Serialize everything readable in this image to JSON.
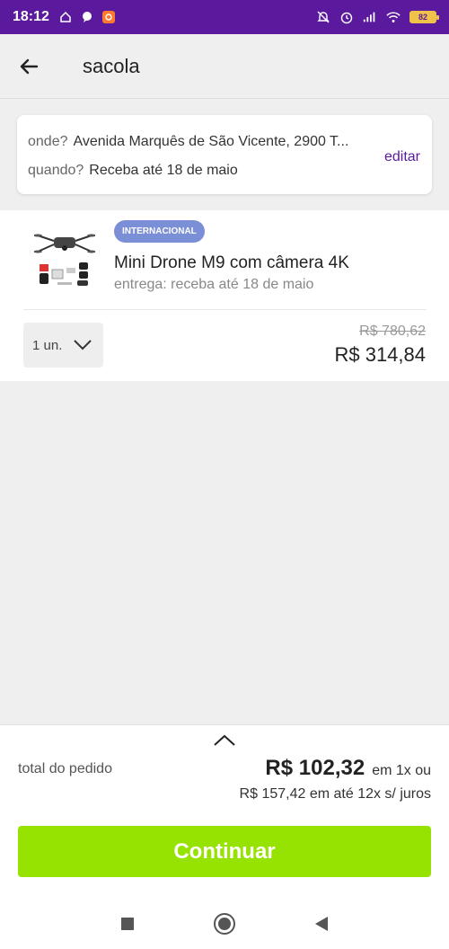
{
  "status_bar": {
    "time": "18:12",
    "battery": "82",
    "left_icons": [
      "home-icon",
      "chat-icon",
      "app-badge-icon"
    ],
    "right_icons": [
      "mute-icon",
      "alarm-icon",
      "signal-icon",
      "wifi-icon",
      "battery-icon"
    ]
  },
  "header": {
    "title": "sacola",
    "back_icon": "arrow-left-icon"
  },
  "address": {
    "where_label": "onde?",
    "where_value": "Avenida Marquês de São Vicente, 2900 T...",
    "when_label": "quando?",
    "when_value": "Receba até 18 de maio",
    "edit_label": "editar"
  },
  "product": {
    "badge": "INTERNACIONAL",
    "name": "Mini Drone M9 com câmera 4K",
    "delivery": "entrega: receba até 18 de maio",
    "quantity": "1 un.",
    "old_price": "R$ 780,62",
    "price": "R$ 314,84"
  },
  "footer": {
    "total_label": "total do pedido",
    "total_value": "R$ 102,32",
    "total_suffix": "em 1x ou",
    "installments": "R$ 157,42 em até 12x s/ juros",
    "continue_label": "Continuar"
  },
  "colors": {
    "status_bar": "#5b1a9e",
    "accent": "#5b1a9e",
    "continue_button": "#96e200",
    "badge": "#7b8fd6"
  },
  "nav_bar": {
    "icons": [
      "recents-square-icon",
      "home-circle-icon",
      "back-triangle-icon"
    ]
  }
}
